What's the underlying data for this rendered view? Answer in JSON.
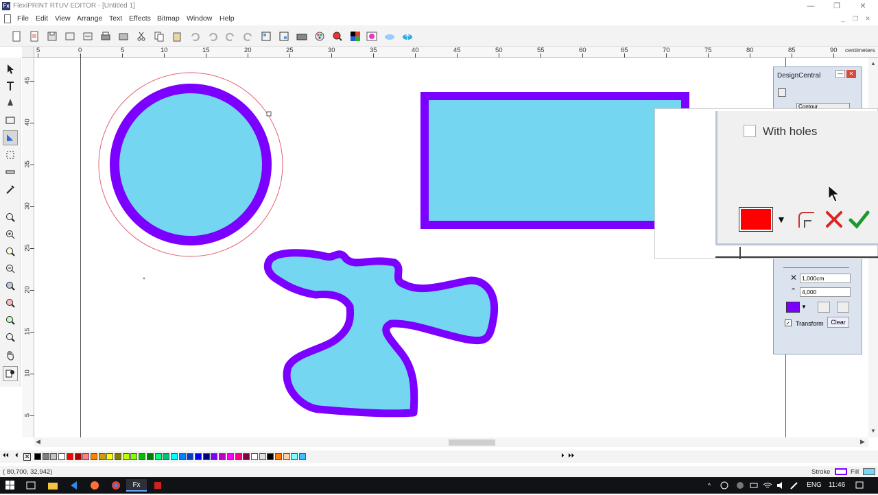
{
  "window": {
    "title": "FlexiPRINT RTUV EDITOR - [Untitled 1]",
    "app_icon": "Fx",
    "minimize": "—",
    "restore": "❐",
    "close": "✕"
  },
  "menu": [
    "File",
    "Edit",
    "View",
    "Arrange",
    "Text",
    "Effects",
    "Bitmap",
    "Window",
    "Help"
  ],
  "ruler": {
    "units": "centimeters",
    "top_labels": [
      "5",
      "0",
      "5",
      "10",
      "15",
      "20",
      "25",
      "30",
      "35",
      "40",
      "45",
      "50",
      "55",
      "60",
      "65",
      "70",
      "75",
      "80",
      "85",
      "90"
    ],
    "left_labels": [
      "45",
      "40",
      "35",
      "30",
      "25",
      "20",
      "15",
      "10",
      "5"
    ]
  },
  "design_central": {
    "title": "DesignCentral",
    "dropdown_value": "Contour",
    "offset_value": "1,000cm",
    "angle_value": "4,000",
    "transform_label": "Transform",
    "transform_checked": true,
    "clear_label": "Clear",
    "contour_color": "#7b00ff"
  },
  "popup": {
    "with_holes_label": "With holes",
    "with_holes_checked": false,
    "color": "#ff0000"
  },
  "palette_colors": [
    "#000000",
    "#7f7f7f",
    "#c3c3c3",
    "#ffffff",
    "#ff0000",
    "#b00000",
    "#ff8080",
    "#ff7f00",
    "#c8a000",
    "#ffff00",
    "#808000",
    "#c0ff00",
    "#80ff00",
    "#00c000",
    "#008000",
    "#00ff80",
    "#00c080",
    "#00ffff",
    "#0080ff",
    "#0040c0",
    "#0000ff",
    "#000080",
    "#8000ff",
    "#c000c0",
    "#ff00ff",
    "#ff0080",
    "#800040",
    "#ffffff",
    "#e0e0e0",
    "#000000",
    "#ff8000",
    "#ffd0a0",
    "#80ffff",
    "#40c0ff"
  ],
  "status": {
    "coordinates": "( 80,700, 32,942)",
    "stroke_label": "Stroke",
    "fill_label": "Fill"
  },
  "taskbar": {
    "language": "ENG",
    "time": "11:46"
  }
}
